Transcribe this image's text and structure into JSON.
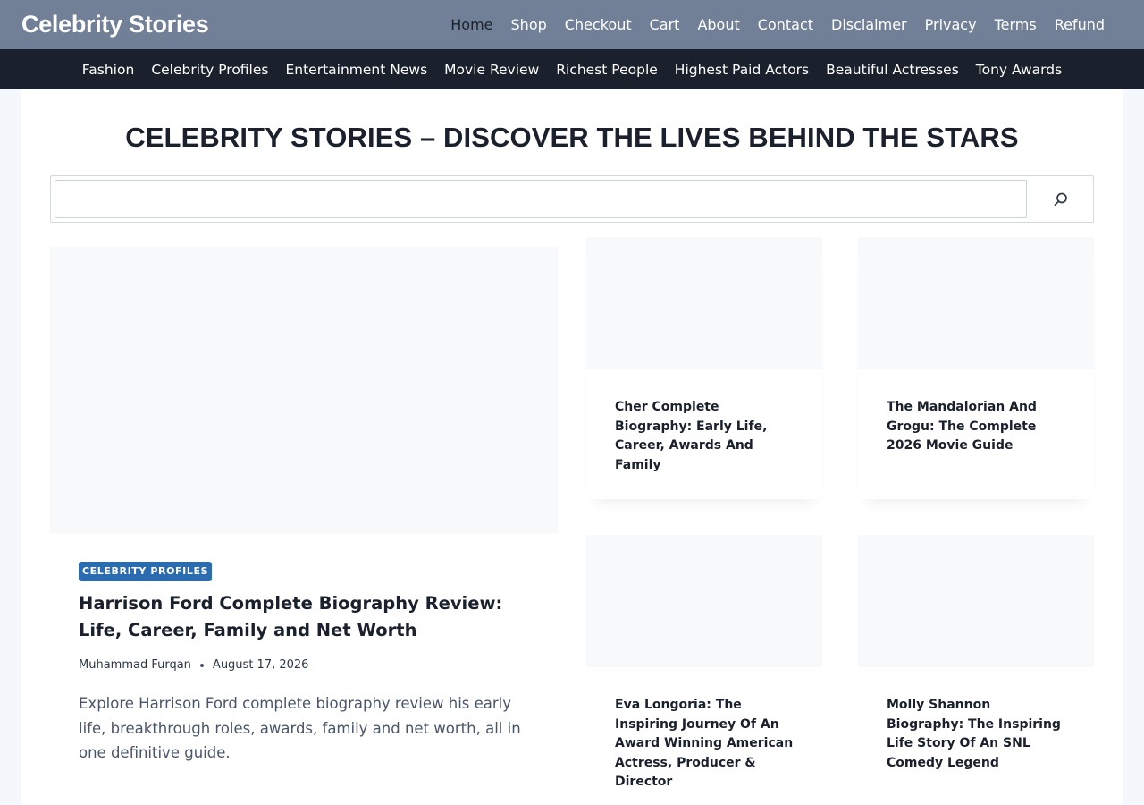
{
  "header": {
    "site_title": "Celebrity Stories",
    "primary_nav": [
      {
        "label": "Home",
        "active": true
      },
      {
        "label": "Shop"
      },
      {
        "label": "Checkout"
      },
      {
        "label": "Cart"
      },
      {
        "label": "About"
      },
      {
        "label": "Contact"
      },
      {
        "label": "Disclaimer"
      },
      {
        "label": "Privacy"
      },
      {
        "label": "Terms"
      },
      {
        "label": "Refund"
      }
    ],
    "secondary_nav": [
      {
        "label": "Fashion"
      },
      {
        "label": "Celebrity Profiles"
      },
      {
        "label": "Entertainment News"
      },
      {
        "label": "Movie Review"
      },
      {
        "label": "Richest People"
      },
      {
        "label": "Highest Paid Actors"
      },
      {
        "label": "Beautiful Actresses"
      },
      {
        "label": "Tony Awards"
      }
    ]
  },
  "main": {
    "page_title": "CELEBRITY STORIES – DISCOVER THE LIVES BEHIND THE STARS",
    "search": {
      "value": "",
      "placeholder": "",
      "icon": "search-icon"
    },
    "featured": {
      "category": "CELEBRITY PROFILES",
      "title": "Harrison Ford Complete Biography Review: Life, Career, Family and Net Worth",
      "author": "Muhammad Furqan",
      "date": "August 17, 2026",
      "excerpt": "Explore Harrison Ford complete biography review his early life, breakthrough roles, awards, family and net worth, all in one definitive guide."
    },
    "cards": [
      {
        "title": "Cher Complete Biography: Early Life, Career, Awards And Family"
      },
      {
        "title": "The Mandalorian And Grogu: The Complete 2026 Movie Guide"
      },
      {
        "title": "Eva Longoria: The Inspiring Journey Of An Award Winning American Actress, Producer & Director"
      },
      {
        "title": "Molly Shannon Biography: The Inspiring Life Story Of An SNL Comedy Legend"
      }
    ]
  },
  "colors": {
    "topbar": "#718096",
    "subbar": "#1a202c",
    "badge": "#2b6cb0",
    "text": "#1a202c"
  }
}
